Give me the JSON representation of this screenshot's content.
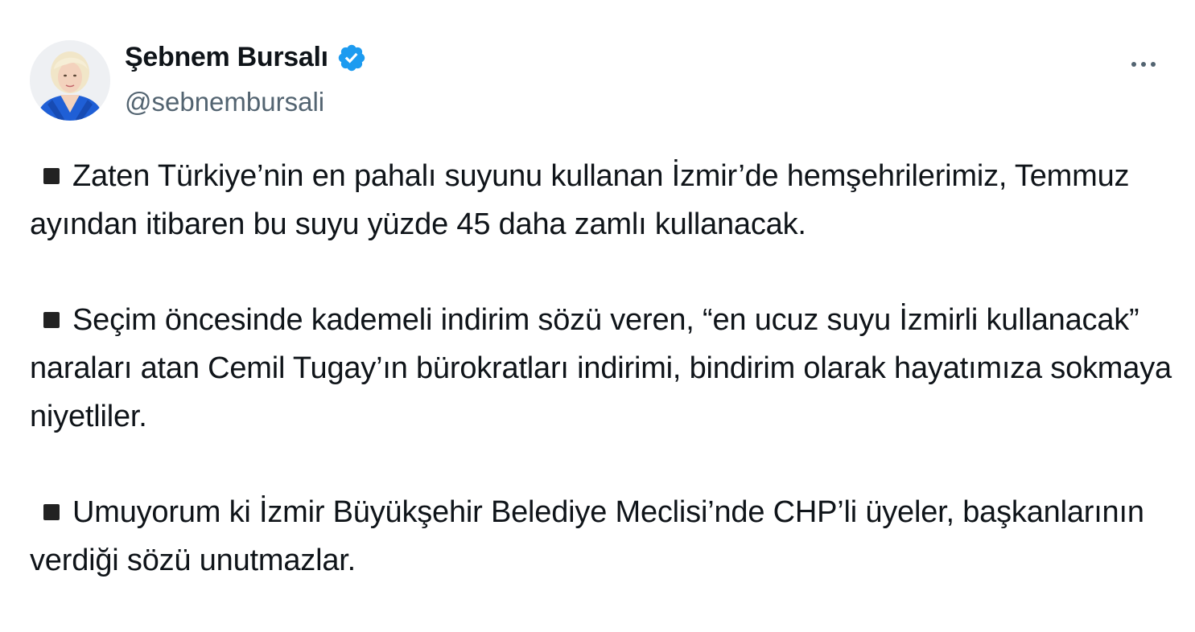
{
  "author": {
    "display_name": "Şebnem Bursalı",
    "handle": "@sebnembursali",
    "avatar_icon": "profile-photo",
    "verified_icon": "verified-badge-icon",
    "verified_color": "#1d9bf0"
  },
  "header": {
    "more_icon": "more-options-icon"
  },
  "tweet": {
    "bullet_icon": "black-square-bullet",
    "paragraphs": [
      "Zaten Türkiye’nin en pahalı suyunu kullanan İzmir’de hemşehrilerimiz, Temmuz ayından itibaren bu suyu yüzde 45 daha zamlı kullanacak.",
      "Seçim öncesinde kademeli indirim sözü veren, “en ucuz suyu İzmirli kullanacak” naraları atan Cemil Tugay’ın bürokratları indirimi, bindirim olarak hayatımıza sokmaya niyetliler.",
      "Umuyorum ki İzmir Büyükşehir Belediye Meclisi’nde CHP’li üyeler, başkanlarının verdiği sözü unutmazlar."
    ]
  },
  "colors": {
    "text": "#0f1419",
    "secondary": "#536471",
    "background": "#ffffff"
  }
}
